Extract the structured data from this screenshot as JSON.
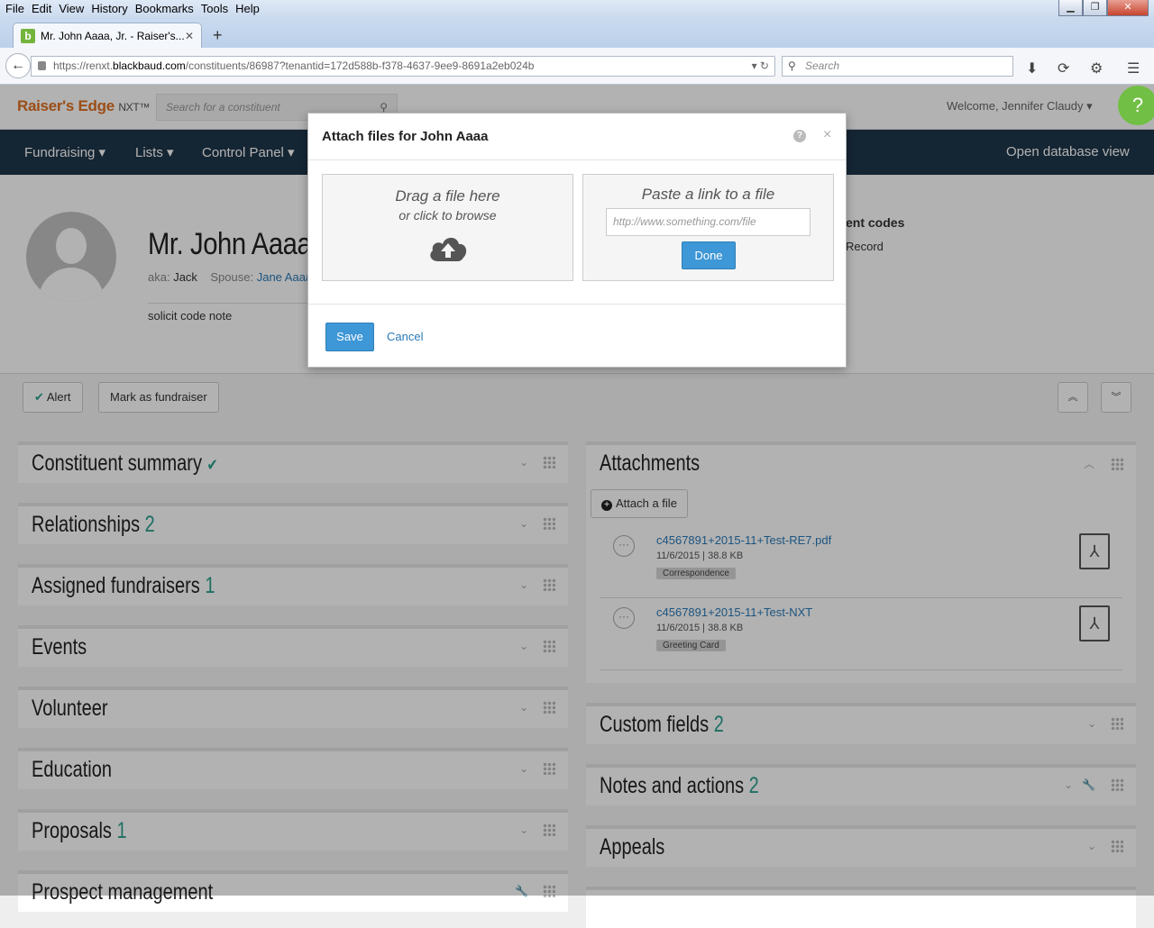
{
  "browser": {
    "menu": [
      "File",
      "Edit",
      "View",
      "History",
      "Bookmarks",
      "Tools",
      "Help"
    ],
    "tab_title": "Mr. John Aaaa, Jr. - Raiser's...",
    "favicon_letter": "b",
    "url_prefix": "https://renxt.",
    "url_domain": "blackbaud.com",
    "url_rest": "/constituents/86987?tenantid=172d588b-f378-4637-9ee9-8691a2eb024b",
    "search_placeholder": "Search"
  },
  "app": {
    "logo": "Raiser's Edge",
    "logo_suffix": "NXT™",
    "search_placeholder": "Search for a constituent",
    "welcome": "Welcome, Jennifer Claudy",
    "nav": [
      "Fundraising",
      "Lists",
      "Control Panel"
    ],
    "open_db": "Open database view"
  },
  "profile": {
    "name": "Mr. John Aaaa, Jr",
    "aka_label": "aka:",
    "aka_value": "Jack",
    "spouse_label": "Spouse:",
    "spouse_value": "Jane Aaaa",
    "note": "solicit code note",
    "right1": "ent codes",
    "right2": "Record"
  },
  "actions": {
    "alert": "Alert",
    "mark": "Mark as fundraiser"
  },
  "tiles_left": [
    {
      "title": "Constituent summary",
      "count": ""
    },
    {
      "title": "Relationships",
      "count": "2"
    },
    {
      "title": "Assigned fundraisers",
      "count": "1"
    },
    {
      "title": "Events",
      "count": ""
    },
    {
      "title": "Volunteer",
      "count": ""
    },
    {
      "title": "Education",
      "count": ""
    },
    {
      "title": "Proposals",
      "count": "1"
    },
    {
      "title": "Prospect management",
      "count": ""
    }
  ],
  "attachments": {
    "title": "Attachments",
    "attach_btn": "Attach a file",
    "items": [
      {
        "name": "c4567891+2015-11+Test-RE7.pdf",
        "meta": "11/6/2015 | 38.8 KB",
        "tag": "Correspondence"
      },
      {
        "name": "c4567891+2015-11+Test-NXT",
        "meta": "11/6/2015 | 38.8 KB",
        "tag": "Greeting Card"
      }
    ]
  },
  "tiles_right": [
    {
      "title": "Custom fields",
      "count": "2"
    },
    {
      "title": "Notes and actions",
      "count": "2"
    },
    {
      "title": "Appeals",
      "count": ""
    }
  ],
  "modal": {
    "title": "Attach files for John Aaaa",
    "drag_title": "Drag a file here",
    "drag_sub": "or click to browse",
    "paste_title": "Paste a link to a file",
    "link_placeholder": "http://www.something.com/file",
    "done": "Done",
    "save": "Save",
    "cancel": "Cancel"
  }
}
